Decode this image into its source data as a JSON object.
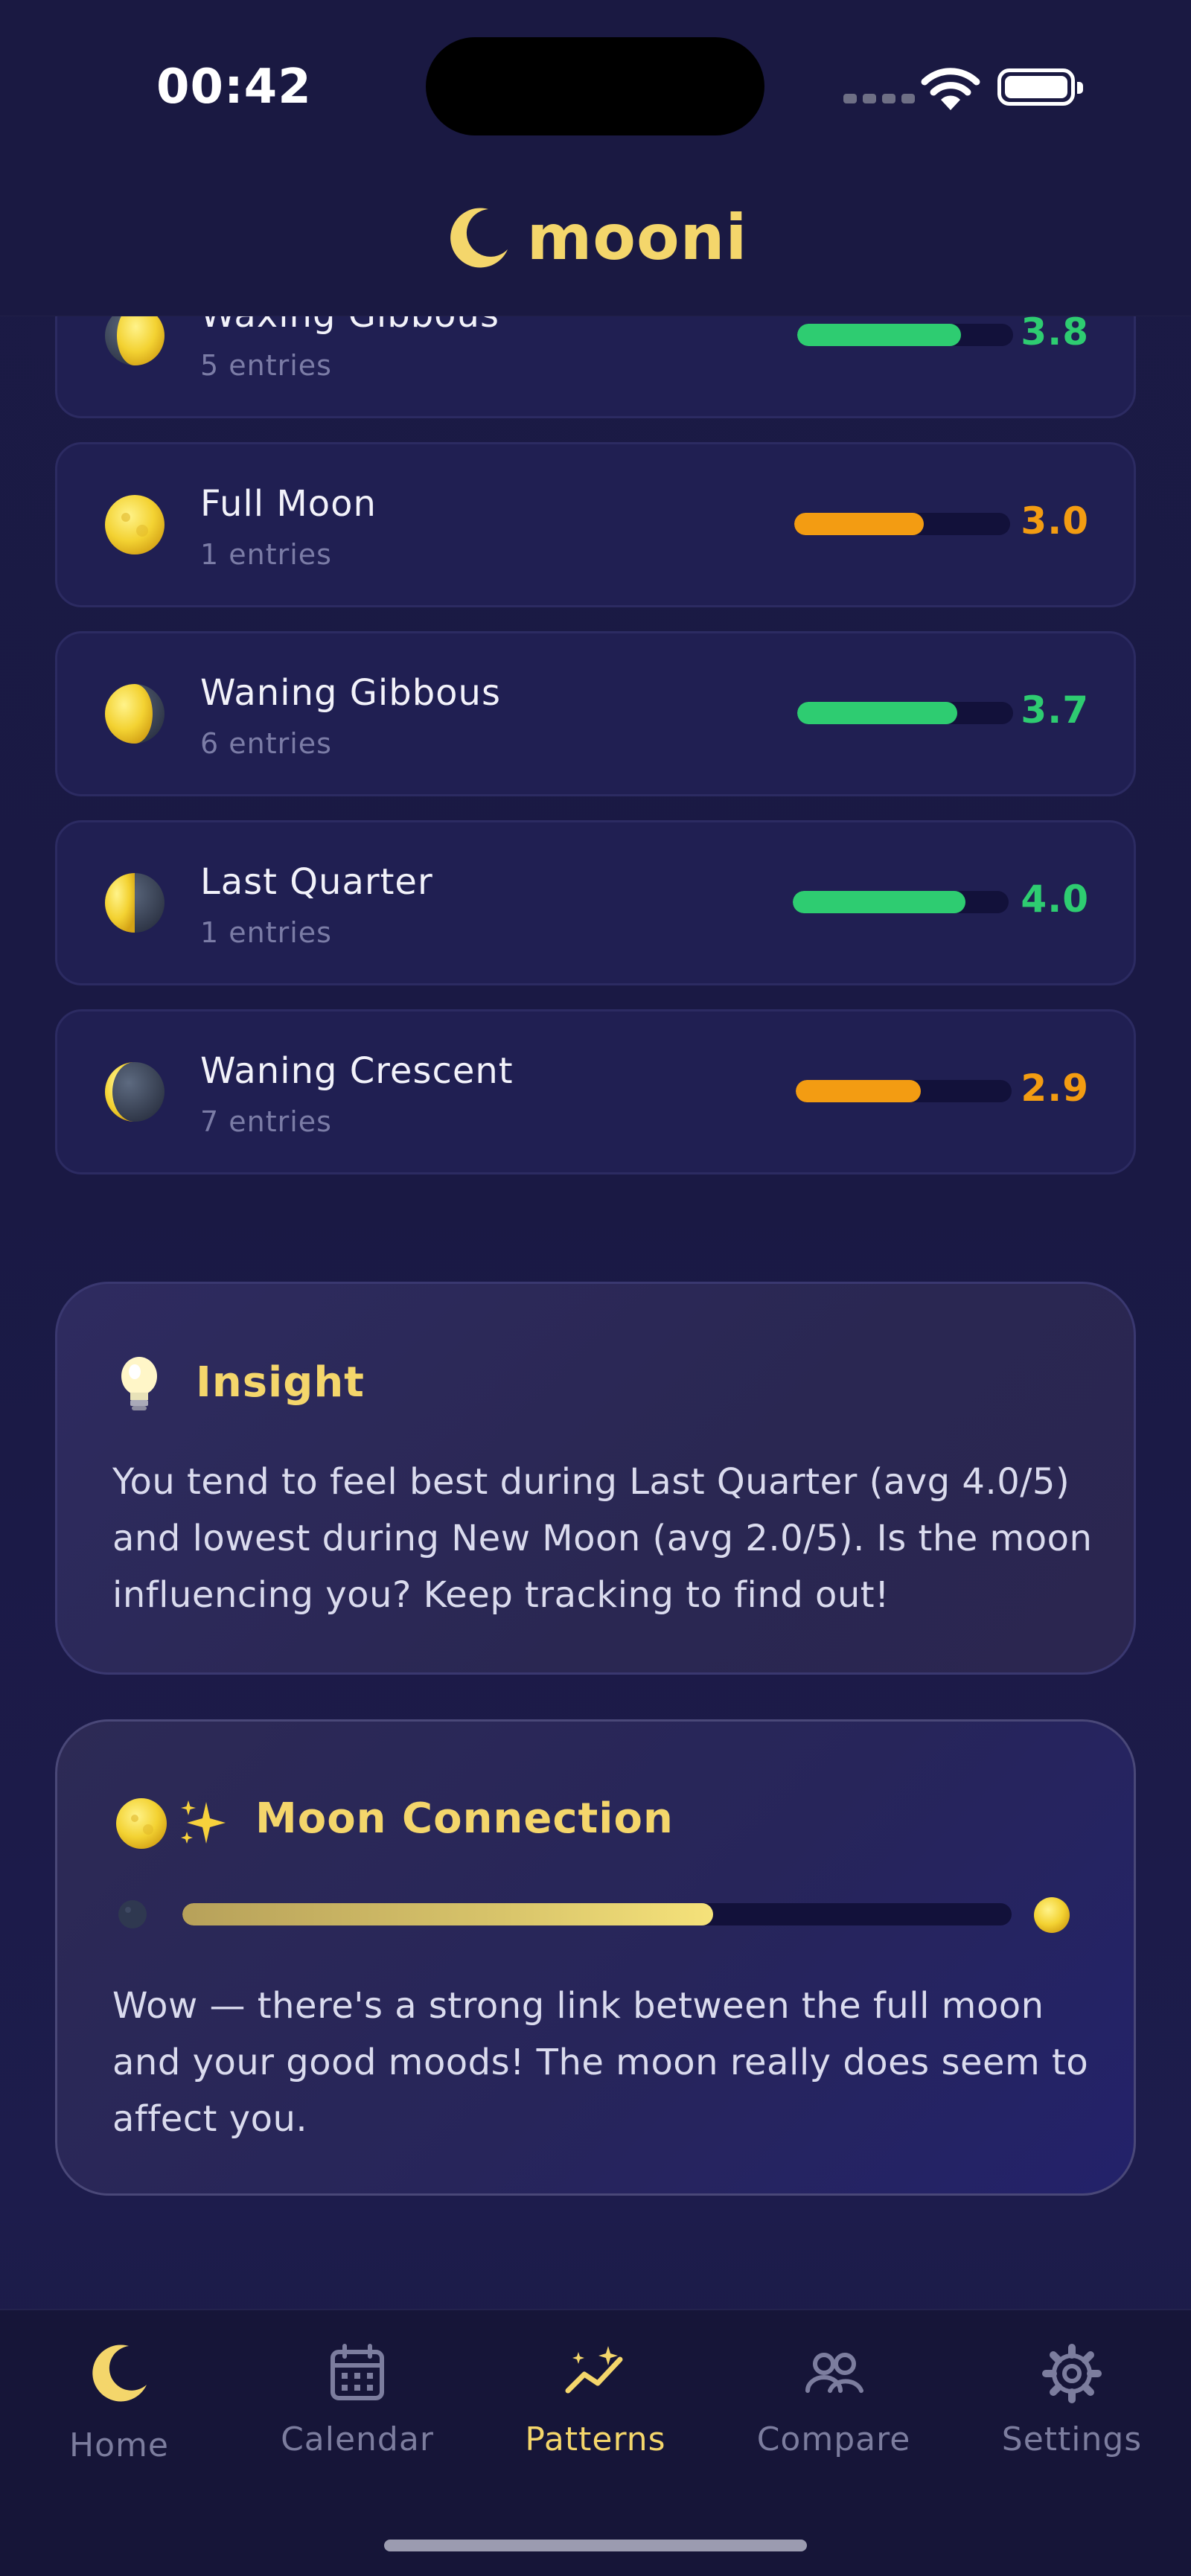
{
  "status_bar": {
    "time": "00:42"
  },
  "header": {
    "title": "mooni"
  },
  "phases": [
    {
      "name": "Waxing Gibbous",
      "entries": "5 entries",
      "score": "3.8",
      "value": 3.8,
      "color": "#2ecc71"
    },
    {
      "name": "Full Moon",
      "entries": "1 entries",
      "score": "3.0",
      "value": 3.0,
      "color": "#f39c12"
    },
    {
      "name": "Waning Gibbous",
      "entries": "6 entries",
      "score": "3.7",
      "value": 3.7,
      "color": "#2ecc71"
    },
    {
      "name": "Last Quarter",
      "entries": "1 entries",
      "score": "4.0",
      "value": 4.0,
      "color": "#2ecc71"
    },
    {
      "name": "Waning Crescent",
      "entries": "7 entries",
      "score": "2.9",
      "value": 2.9,
      "color": "#f39c12"
    }
  ],
  "insight": {
    "title": "Insight",
    "text": "You tend to feel best during Last Quarter (avg 4.0/5) and lowest during New Moon (avg 2.0/5). Is the moon influencing you? Keep tracking to find out!"
  },
  "moon_connection": {
    "title": "Moon Connection",
    "strength": 0.64,
    "text": "Wow — there's a strong link between the full moon and your good moods! The moon really does seem to affect you."
  },
  "nav": {
    "home": "Home",
    "calendar": "Calendar",
    "patterns": "Patterns",
    "compare": "Compare",
    "settings": "Settings"
  },
  "colors": {
    "accent": "#f4d66b",
    "good": "#2ecc71",
    "mid": "#f39c12",
    "background": "#1a1942"
  }
}
